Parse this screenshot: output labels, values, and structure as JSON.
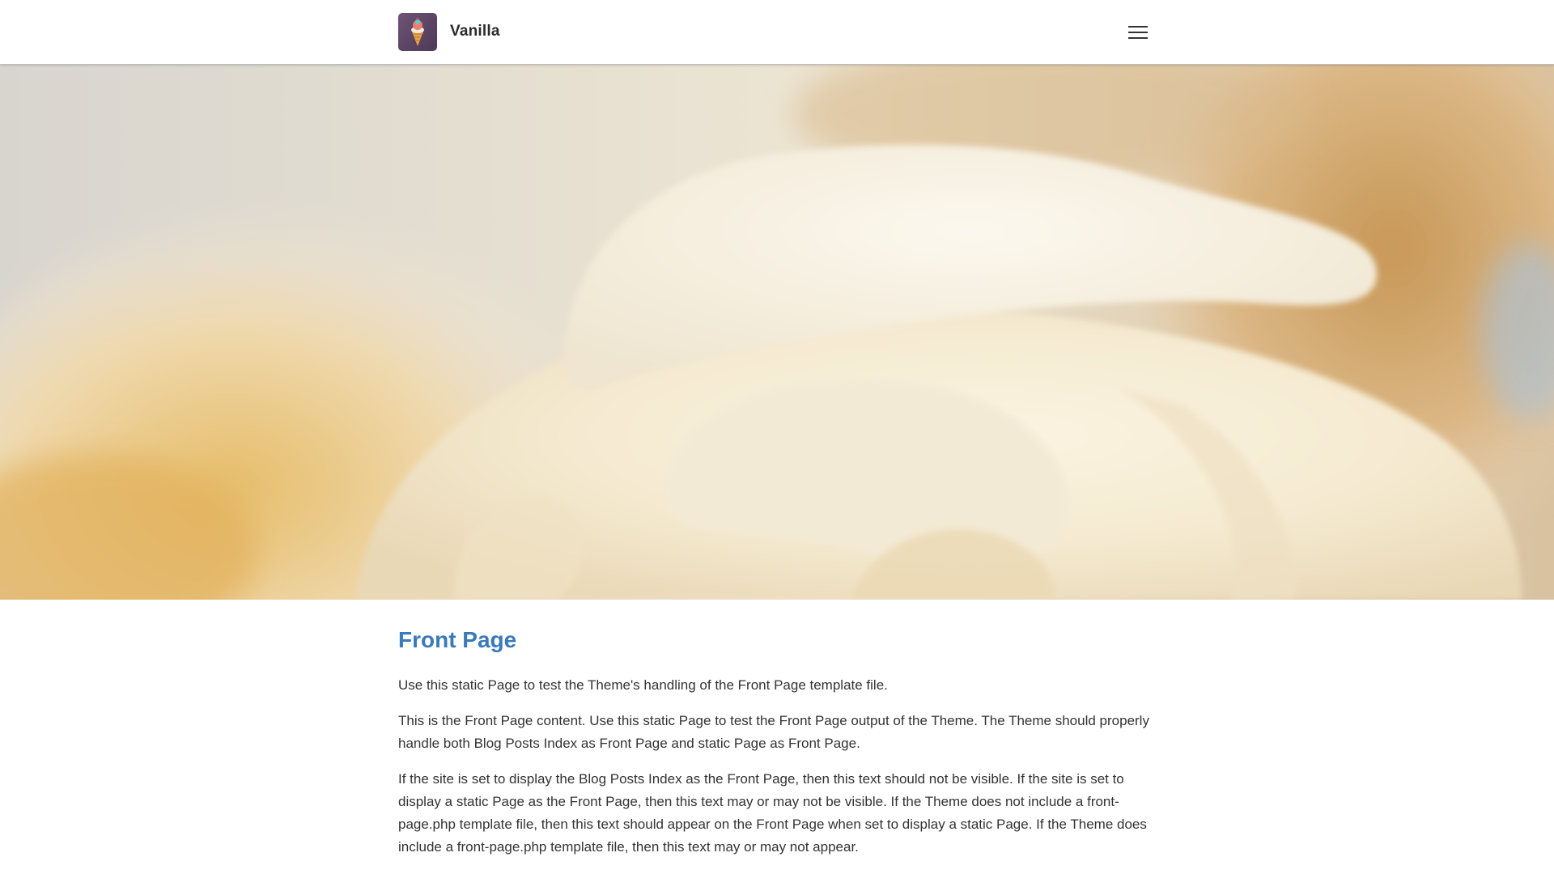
{
  "header": {
    "site_title": "Vanilla",
    "logo_icon": "ice-cream-cone-icon",
    "menu_icon": "hamburger-menu-icon"
  },
  "hero": {
    "image": "vanilla-ice-cream-scoop-photo"
  },
  "article": {
    "title": "Front Page",
    "paragraphs": [
      "Use this static Page to test the Theme's handling of the Front Page template file.",
      "This is the Front Page content. Use this static Page to test the Front Page output of the Theme. The Theme should properly handle both Blog Posts Index as Front Page and static Page as Front Page.",
      "If the site is set to display the Blog Posts Index as the Front Page, then this text should not be visible. If the site is set to display a static Page as the Front Page, then this text may or may not be visible. If the Theme does not include a front-page.php template file, then this text should appear on the Front Page when set to display a static Page. If the Theme does include a front-page.php template file, then this text may or may not appear."
    ]
  },
  "colors": {
    "title_accent": "#3a79ba",
    "logo_background": "#5b4564",
    "text": "#333333"
  }
}
